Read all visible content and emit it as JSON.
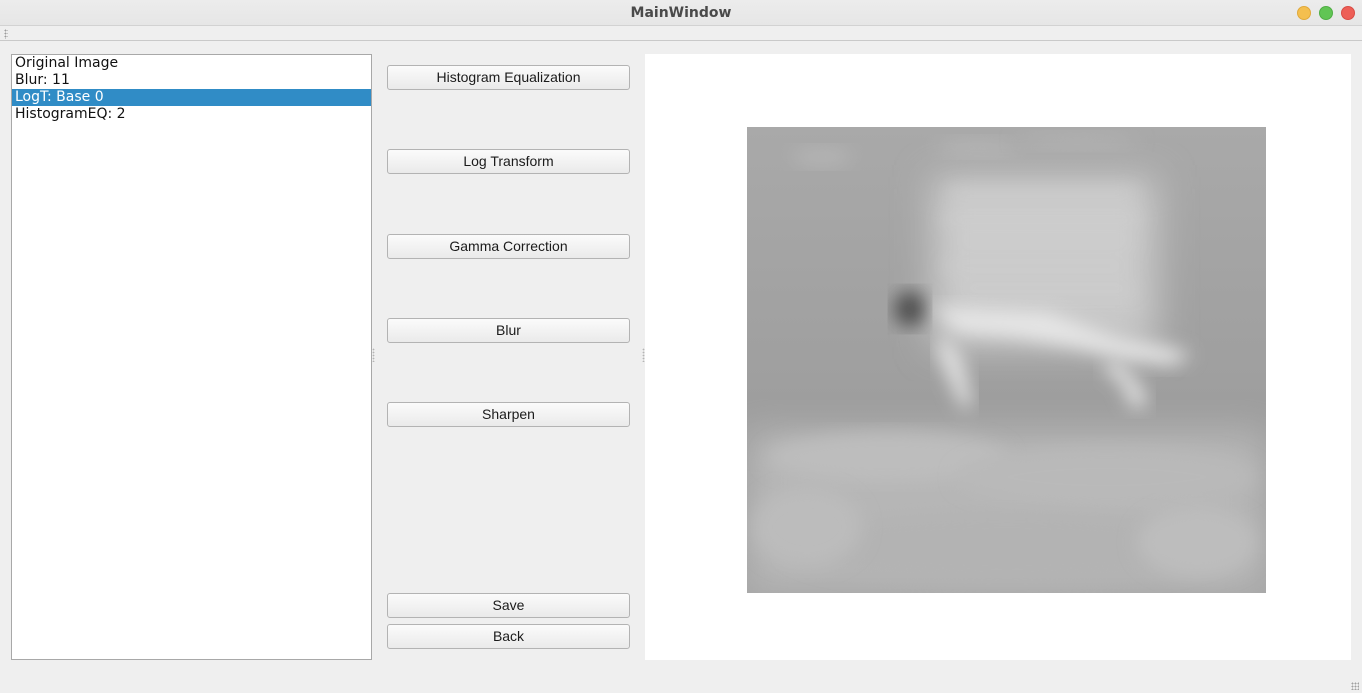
{
  "window": {
    "title": "MainWindow"
  },
  "history": {
    "items": [
      {
        "label": "Original Image"
      },
      {
        "label": "Blur: 11"
      },
      {
        "label": "LogT: Base 0"
      },
      {
        "label": "HistogramEQ: 2"
      }
    ],
    "selected_index": 2
  },
  "buttons": {
    "histogram": "Histogram Equalization",
    "log": "Log Transform",
    "gamma": "Gamma Correction",
    "blur": "Blur",
    "sharpen": "Sharpen",
    "save": "Save",
    "back": "Back"
  },
  "colors": {
    "selection": "#308cc6",
    "window_bg": "#efefef"
  },
  "icons": {
    "minimize": "minimize-icon",
    "maximize": "maximize-icon",
    "close": "close-icon"
  }
}
